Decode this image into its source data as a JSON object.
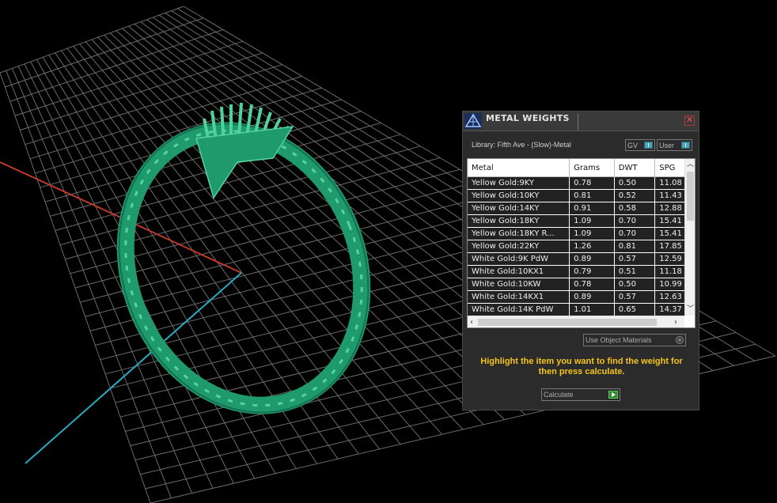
{
  "colors": {
    "ring": "#1f9a6c",
    "grid": "#6a6a6a",
    "axis_x": "#c0392b",
    "axis_z": "#2aa8c0",
    "hint_text": "#f5c518"
  },
  "panel": {
    "title": "METAL WEIGHTS",
    "close_label": "✕",
    "library": "Library: Fifth Ave - (Slow)-Metal",
    "toggle_gv": "GV",
    "toggle_user": "User",
    "columns": [
      "Metal",
      "Grams",
      "DWT",
      "SPG"
    ],
    "rows": [
      [
        "Yellow Gold:9KY",
        "0.78",
        "0.50",
        "11.08"
      ],
      [
        "Yellow Gold:10KY",
        "0.81",
        "0.52",
        "11.43"
      ],
      [
        "Yellow Gold:14KY",
        "0.91",
        "0.58",
        "12.88"
      ],
      [
        "Yellow Gold:18KY",
        "1.09",
        "0.70",
        "15.41"
      ],
      [
        "Yellow Gold:18KY R...",
        "1.09",
        "0.70",
        "15.41"
      ],
      [
        "Yellow Gold:22KY",
        "1.26",
        "0.81",
        "17.85"
      ],
      [
        "White Gold:9K PdW",
        "0.89",
        "0.57",
        "12.59"
      ],
      [
        "White Gold:10KX1",
        "0.79",
        "0.51",
        "11.18"
      ],
      [
        "White Gold:10KW",
        "0.78",
        "0.50",
        "10.99"
      ],
      [
        "White Gold:14KX1",
        "0.89",
        "0.57",
        "12.63"
      ],
      [
        "White Gold:14K PdW",
        "1.01",
        "0.65",
        "14.37"
      ]
    ],
    "use_object_materials": "Use Object Materials",
    "hint": "Highlight the item you want to find the weight for then press calculate.",
    "calculate_label": "Calculate"
  },
  "icons": {
    "logo": "pyramid-logo-icon",
    "close": "close-icon",
    "scroll_up": "chevron-up-icon",
    "scroll_down": "chevron-down-icon",
    "scroll_left": "chevron-left-icon",
    "scroll_right": "chevron-right-icon",
    "calculate": "play-arrow-icon"
  }
}
